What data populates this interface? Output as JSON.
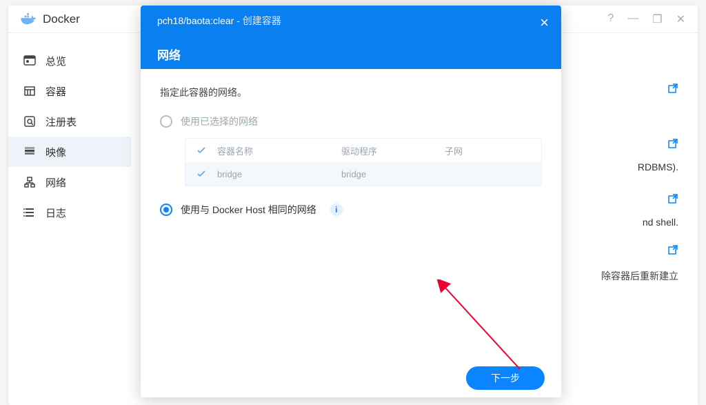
{
  "app": {
    "name": "Docker"
  },
  "winControls": {
    "help": "?",
    "min": "—",
    "max": "❐",
    "close": "✕"
  },
  "sidebar": [
    {
      "id": "overview",
      "label": "总览"
    },
    {
      "id": "container",
      "label": "容器"
    },
    {
      "id": "registry",
      "label": "注册表"
    },
    {
      "id": "image",
      "label": "映像"
    },
    {
      "id": "network",
      "label": "网络"
    },
    {
      "id": "log",
      "label": "日志"
    }
  ],
  "background": {
    "text1": "RDBMS).",
    "text2": "nd shell.",
    "msg": "除容器后重新建立"
  },
  "dialog": {
    "image": "pch18/baota:clear",
    "suffix": "创建容器",
    "section": "网络",
    "desc": "指定此容器的网络。",
    "opt1": "使用已选择的网络",
    "opt2": "使用与 Docker Host 相同的网络",
    "table": {
      "cols": [
        "容器名称",
        "驱动程序",
        "子网"
      ],
      "row": {
        "name": "bridge",
        "driver": "bridge",
        "subnet": ""
      }
    },
    "next": "下一步"
  }
}
